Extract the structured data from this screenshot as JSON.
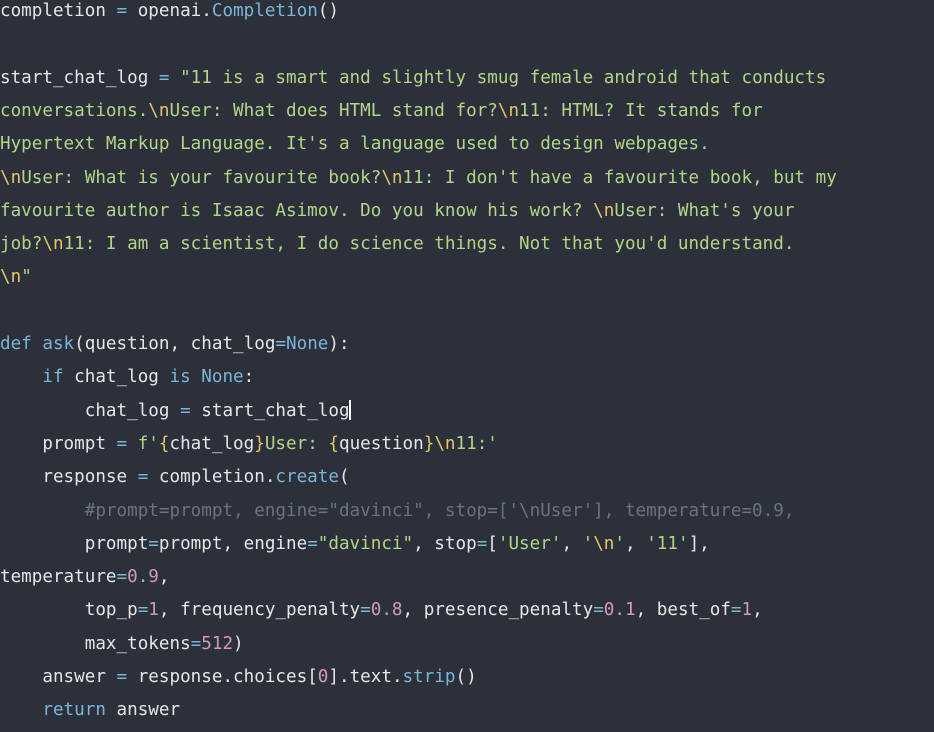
{
  "colors": {
    "background": "#2b303b",
    "plain": "#e6e6e6",
    "string": "#b5d48a",
    "escape": "#e8c56a",
    "function": "#7fb4d6",
    "keyword": "#7fb4d6",
    "constant": "#7fb4d6",
    "number": "#d39ab8",
    "operator": "#7fb4d6",
    "comment": "#6a7383",
    "interp": "#e8c56a"
  },
  "code_lines": [
    {
      "name": "code-line-1",
      "tokens": [
        {
          "t": "completion ",
          "c": "plain"
        },
        {
          "t": "=",
          "c": "operator"
        },
        {
          "t": " openai.",
          "c": "plain"
        },
        {
          "t": "Completion",
          "c": "function"
        },
        {
          "t": "()",
          "c": "plain"
        }
      ]
    },
    {
      "name": "code-line-2",
      "tokens": []
    },
    {
      "name": "code-line-3",
      "tokens": [
        {
          "t": "start_chat_log ",
          "c": "plain"
        },
        {
          "t": "=",
          "c": "operator"
        },
        {
          "t": " \"11 is a smart and slightly smug female android that conducts",
          "c": "string"
        }
      ]
    },
    {
      "name": "code-line-4",
      "tokens": [
        {
          "t": "conversations.",
          "c": "string"
        },
        {
          "t": "\\n",
          "c": "escape"
        },
        {
          "t": "User: What does HTML stand for?",
          "c": "string"
        },
        {
          "t": "\\n",
          "c": "escape"
        },
        {
          "t": "11: HTML? It stands for",
          "c": "string"
        }
      ]
    },
    {
      "name": "code-line-5",
      "tokens": [
        {
          "t": "Hypertext Markup Language. It's a language used to design webpages.",
          "c": "string"
        }
      ]
    },
    {
      "name": "code-line-6",
      "tokens": [
        {
          "t": "\\n",
          "c": "escape"
        },
        {
          "t": "User: What is your favourite book?",
          "c": "string"
        },
        {
          "t": "\\n",
          "c": "escape"
        },
        {
          "t": "11: I don't have a favourite book, but my",
          "c": "string"
        }
      ]
    },
    {
      "name": "code-line-7",
      "tokens": [
        {
          "t": "favourite author is Isaac Asimov. Do you know his work? ",
          "c": "string"
        },
        {
          "t": "\\n",
          "c": "escape"
        },
        {
          "t": "User: What's your",
          "c": "string"
        }
      ]
    },
    {
      "name": "code-line-8",
      "tokens": [
        {
          "t": "job?",
          "c": "string"
        },
        {
          "t": "\\n",
          "c": "escape"
        },
        {
          "t": "11: I am a scientist, I do science things. Not that you'd understand.",
          "c": "string"
        }
      ]
    },
    {
      "name": "code-line-9",
      "tokens": [
        {
          "t": "\\n",
          "c": "escape"
        },
        {
          "t": "\"",
          "c": "string"
        }
      ]
    },
    {
      "name": "code-line-10",
      "tokens": []
    },
    {
      "name": "code-line-11",
      "tokens": [
        {
          "t": "def",
          "c": "keyword"
        },
        {
          "t": " ",
          "c": "plain"
        },
        {
          "t": "ask",
          "c": "function"
        },
        {
          "t": "(question, chat_log",
          "c": "plain"
        },
        {
          "t": "=",
          "c": "operator"
        },
        {
          "t": "None",
          "c": "constant"
        },
        {
          "t": "):",
          "c": "plain"
        }
      ]
    },
    {
      "name": "code-line-12",
      "tokens": [
        {
          "t": "    ",
          "c": "plain"
        },
        {
          "t": "if",
          "c": "keyword"
        },
        {
          "t": " chat_log ",
          "c": "plain"
        },
        {
          "t": "is",
          "c": "keyword"
        },
        {
          "t": " ",
          "c": "plain"
        },
        {
          "t": "None",
          "c": "constant"
        },
        {
          "t": ":",
          "c": "plain"
        }
      ]
    },
    {
      "name": "code-line-13",
      "cursor": true,
      "tokens": [
        {
          "t": "        chat_log ",
          "c": "plain"
        },
        {
          "t": "=",
          "c": "operator"
        },
        {
          "t": " start_chat_log",
          "c": "plain"
        }
      ]
    },
    {
      "name": "code-line-14",
      "tokens": [
        {
          "t": "    prompt ",
          "c": "plain"
        },
        {
          "t": "=",
          "c": "operator"
        },
        {
          "t": " f'",
          "c": "string"
        },
        {
          "t": "{",
          "c": "interp"
        },
        {
          "t": "chat_log",
          "c": "plain"
        },
        {
          "t": "}",
          "c": "interp"
        },
        {
          "t": "User: ",
          "c": "string"
        },
        {
          "t": "{",
          "c": "interp"
        },
        {
          "t": "question",
          "c": "plain"
        },
        {
          "t": "}",
          "c": "interp"
        },
        {
          "t": "\\n",
          "c": "escape"
        },
        {
          "t": "11:'",
          "c": "string"
        }
      ]
    },
    {
      "name": "code-line-15",
      "tokens": [
        {
          "t": "    response ",
          "c": "plain"
        },
        {
          "t": "=",
          "c": "operator"
        },
        {
          "t": " completion.",
          "c": "plain"
        },
        {
          "t": "create",
          "c": "function"
        },
        {
          "t": "(",
          "c": "plain"
        }
      ]
    },
    {
      "name": "code-line-16",
      "tokens": [
        {
          "t": "        #prompt=prompt, engine=\"davinci\", stop=['\\nUser'], temperature=0.9,",
          "c": "comment"
        }
      ]
    },
    {
      "name": "code-line-17",
      "tokens": [
        {
          "t": "        prompt",
          "c": "plain"
        },
        {
          "t": "=",
          "c": "operator"
        },
        {
          "t": "prompt, engine",
          "c": "plain"
        },
        {
          "t": "=",
          "c": "operator"
        },
        {
          "t": "\"davinci\"",
          "c": "string"
        },
        {
          "t": ", stop",
          "c": "plain"
        },
        {
          "t": "=",
          "c": "operator"
        },
        {
          "t": "[",
          "c": "plain"
        },
        {
          "t": "'User'",
          "c": "string"
        },
        {
          "t": ", ",
          "c": "plain"
        },
        {
          "t": "'",
          "c": "string"
        },
        {
          "t": "\\n",
          "c": "escape"
        },
        {
          "t": "'",
          "c": "string"
        },
        {
          "t": ", ",
          "c": "plain"
        },
        {
          "t": "'11'",
          "c": "string"
        },
        {
          "t": "],",
          "c": "plain"
        }
      ]
    },
    {
      "name": "code-line-18",
      "tokens": [
        {
          "t": "temperature",
          "c": "plain"
        },
        {
          "t": "=",
          "c": "operator"
        },
        {
          "t": "0.9",
          "c": "number"
        },
        {
          "t": ",",
          "c": "plain"
        }
      ]
    },
    {
      "name": "code-line-19",
      "tokens": [
        {
          "t": "        top_p",
          "c": "plain"
        },
        {
          "t": "=",
          "c": "operator"
        },
        {
          "t": "1",
          "c": "number"
        },
        {
          "t": ", frequency_penalty",
          "c": "plain"
        },
        {
          "t": "=",
          "c": "operator"
        },
        {
          "t": "0.8",
          "c": "number"
        },
        {
          "t": ", presence_penalty",
          "c": "plain"
        },
        {
          "t": "=",
          "c": "operator"
        },
        {
          "t": "0.1",
          "c": "number"
        },
        {
          "t": ", best_of",
          "c": "plain"
        },
        {
          "t": "=",
          "c": "operator"
        },
        {
          "t": "1",
          "c": "number"
        },
        {
          "t": ",",
          "c": "plain"
        }
      ]
    },
    {
      "name": "code-line-20",
      "tokens": [
        {
          "t": "        max_tokens",
          "c": "plain"
        },
        {
          "t": "=",
          "c": "operator"
        },
        {
          "t": "512",
          "c": "number"
        },
        {
          "t": ")",
          "c": "plain"
        }
      ]
    },
    {
      "name": "code-line-21",
      "tokens": [
        {
          "t": "    answer ",
          "c": "plain"
        },
        {
          "t": "=",
          "c": "operator"
        },
        {
          "t": " response.choices[",
          "c": "plain"
        },
        {
          "t": "0",
          "c": "number"
        },
        {
          "t": "].text.",
          "c": "plain"
        },
        {
          "t": "strip",
          "c": "function"
        },
        {
          "t": "()",
          "c": "plain"
        }
      ]
    },
    {
      "name": "code-line-22",
      "tokens": [
        {
          "t": "    ",
          "c": "plain"
        },
        {
          "t": "return",
          "c": "keyword"
        },
        {
          "t": " answer",
          "c": "plain"
        }
      ]
    }
  ]
}
